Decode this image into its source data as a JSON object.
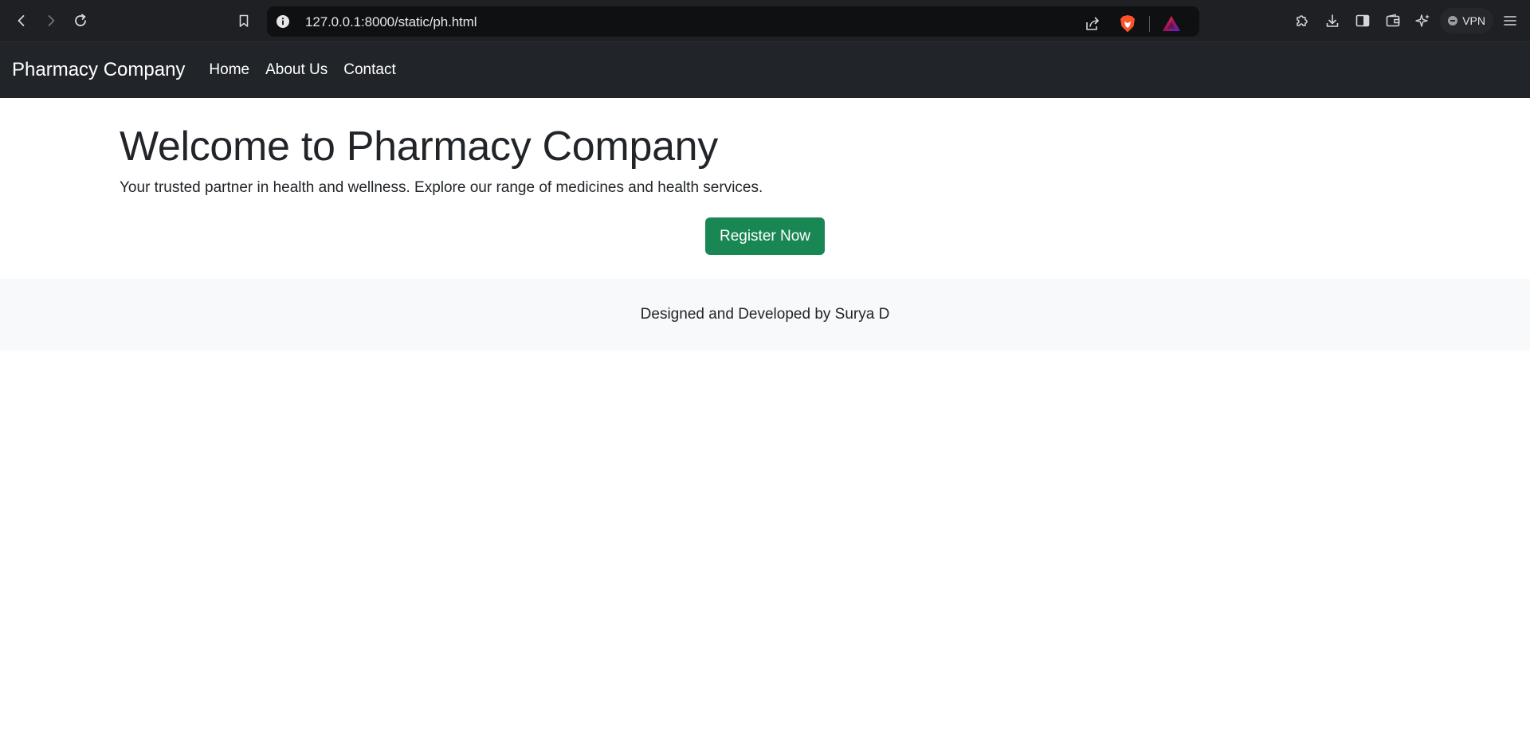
{
  "browser": {
    "url": "127.0.0.1:8000/static/ph.html",
    "vpn_label": "VPN",
    "icons": [
      "back-icon",
      "forward-icon",
      "reload-icon",
      "bookmark-icon",
      "site-info-icon",
      "share-icon",
      "brave-shields-icon",
      "brave-rewards-icon",
      "extensions-icon",
      "downloads-icon",
      "sidebar-icon",
      "wallet-icon",
      "leo-ai-icon",
      "menu-icon"
    ]
  },
  "navbar": {
    "brand": "Pharmacy Company",
    "links": [
      "Home",
      "About Us",
      "Contact"
    ]
  },
  "hero": {
    "title": "Welcome to Pharmacy Company",
    "text": "Your trusted partner in health and wellness. Explore our range of medicines and health services.",
    "button_label": "Register Now"
  },
  "footer": {
    "text": "Designed and Developed by Surya D"
  },
  "colors": {
    "navbar_bg": "#212529",
    "button_bg": "#198754",
    "footer_bg": "#f8f9fa",
    "chrome_bg": "#1f2023"
  }
}
